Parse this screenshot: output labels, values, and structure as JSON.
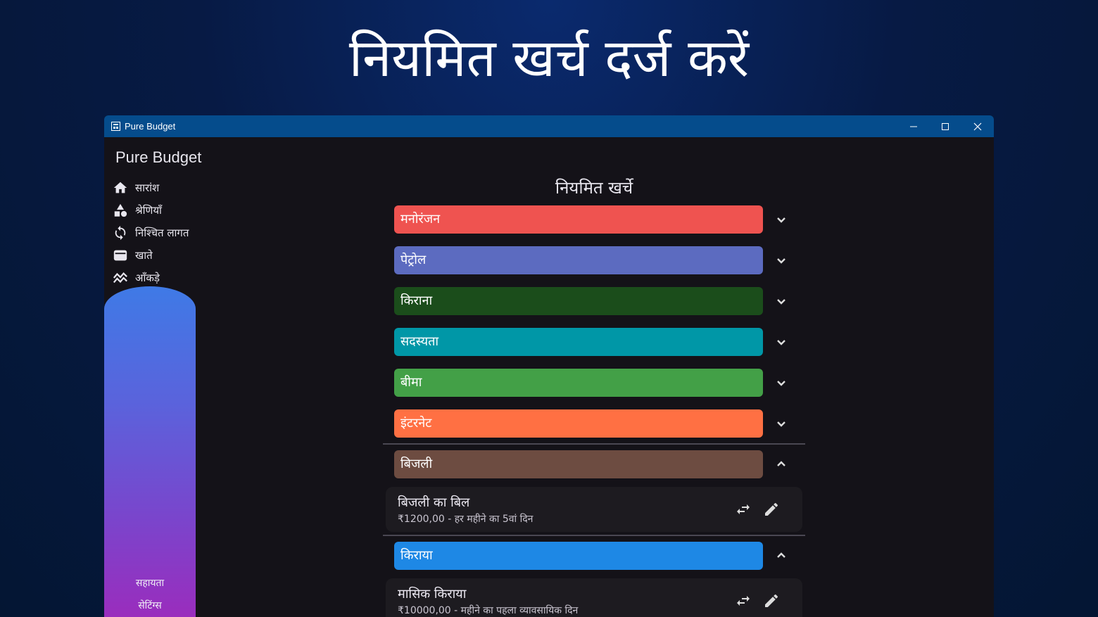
{
  "hero": {
    "headline": "नियमित खर्च दर्ज करें"
  },
  "window": {
    "title": "Pure Budget",
    "controls": [
      "minimize",
      "maximize",
      "close"
    ]
  },
  "sidebar": {
    "brand": "Pure Budget",
    "items": [
      {
        "label": "सारांश",
        "icon": "home-icon"
      },
      {
        "label": "श्रेणियाँ",
        "icon": "shapes-icon"
      },
      {
        "label": "निश्चित लागत",
        "icon": "recurring-icon"
      },
      {
        "label": "खाते",
        "icon": "wallet-icon"
      },
      {
        "label": "आँकड़े",
        "icon": "stats-icon"
      }
    ],
    "help": "सहायता",
    "settings": "सेटिंग्स"
  },
  "main": {
    "title": "नियमित खर्चे",
    "categories": [
      {
        "name": "मनोरंजन",
        "color": "#ef5350",
        "expanded": false
      },
      {
        "name": "पेट्रोल",
        "color": "#5c6bc0",
        "expanded": false
      },
      {
        "name": "किराना",
        "color": "#1b4d1b",
        "expanded": false
      },
      {
        "name": "सदस्यता",
        "color": "#0097a7",
        "expanded": false
      },
      {
        "name": "बीमा",
        "color": "#43a047",
        "expanded": false
      },
      {
        "name": "इंटरनेट",
        "color": "#ff7043",
        "expanded": false
      },
      {
        "name": "बिजली",
        "color": "#6d4c41",
        "expanded": true
      },
      {
        "name": "किराया",
        "color": "#1e88e5",
        "expanded": true
      }
    ],
    "expenses": [
      {
        "category": "बिजली",
        "name": "बिजली का बिल",
        "detail": "₹1200,00 - हर महीने का 5वां दिन"
      },
      {
        "category": "किराया",
        "name": "मासिक किराया",
        "detail": "₹10000,00 - महीने का पहला व्यावसायिक दिन"
      }
    ]
  },
  "colors": {
    "accent": "#054c8c",
    "background": "#141218"
  }
}
